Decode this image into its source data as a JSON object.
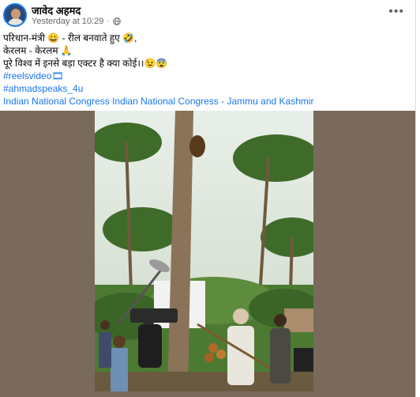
{
  "post": {
    "author": "जावेद अहमद",
    "timestamp": "Yesterday at 10:29",
    "separator": "·",
    "more_label": "•••",
    "lines": [
      "परिधान-मंत्री 😀 - रील बनवाते हुए 🤣,",
      "केरलम - केरलम 🙏",
      "पूरे विश्व में इनसे बड़ा एक्टर है क्या कोई।।😉😨"
    ],
    "hashtags": [
      "#reelsvideo🎞",
      "#ahmadspeaks_4u"
    ],
    "mentions": "Indian National Congress Indian National Congress - Jammu and Kashmir",
    "link_color": "#1877f2",
    "icons": [
      "globe-icon",
      "more-options-icon"
    ]
  }
}
